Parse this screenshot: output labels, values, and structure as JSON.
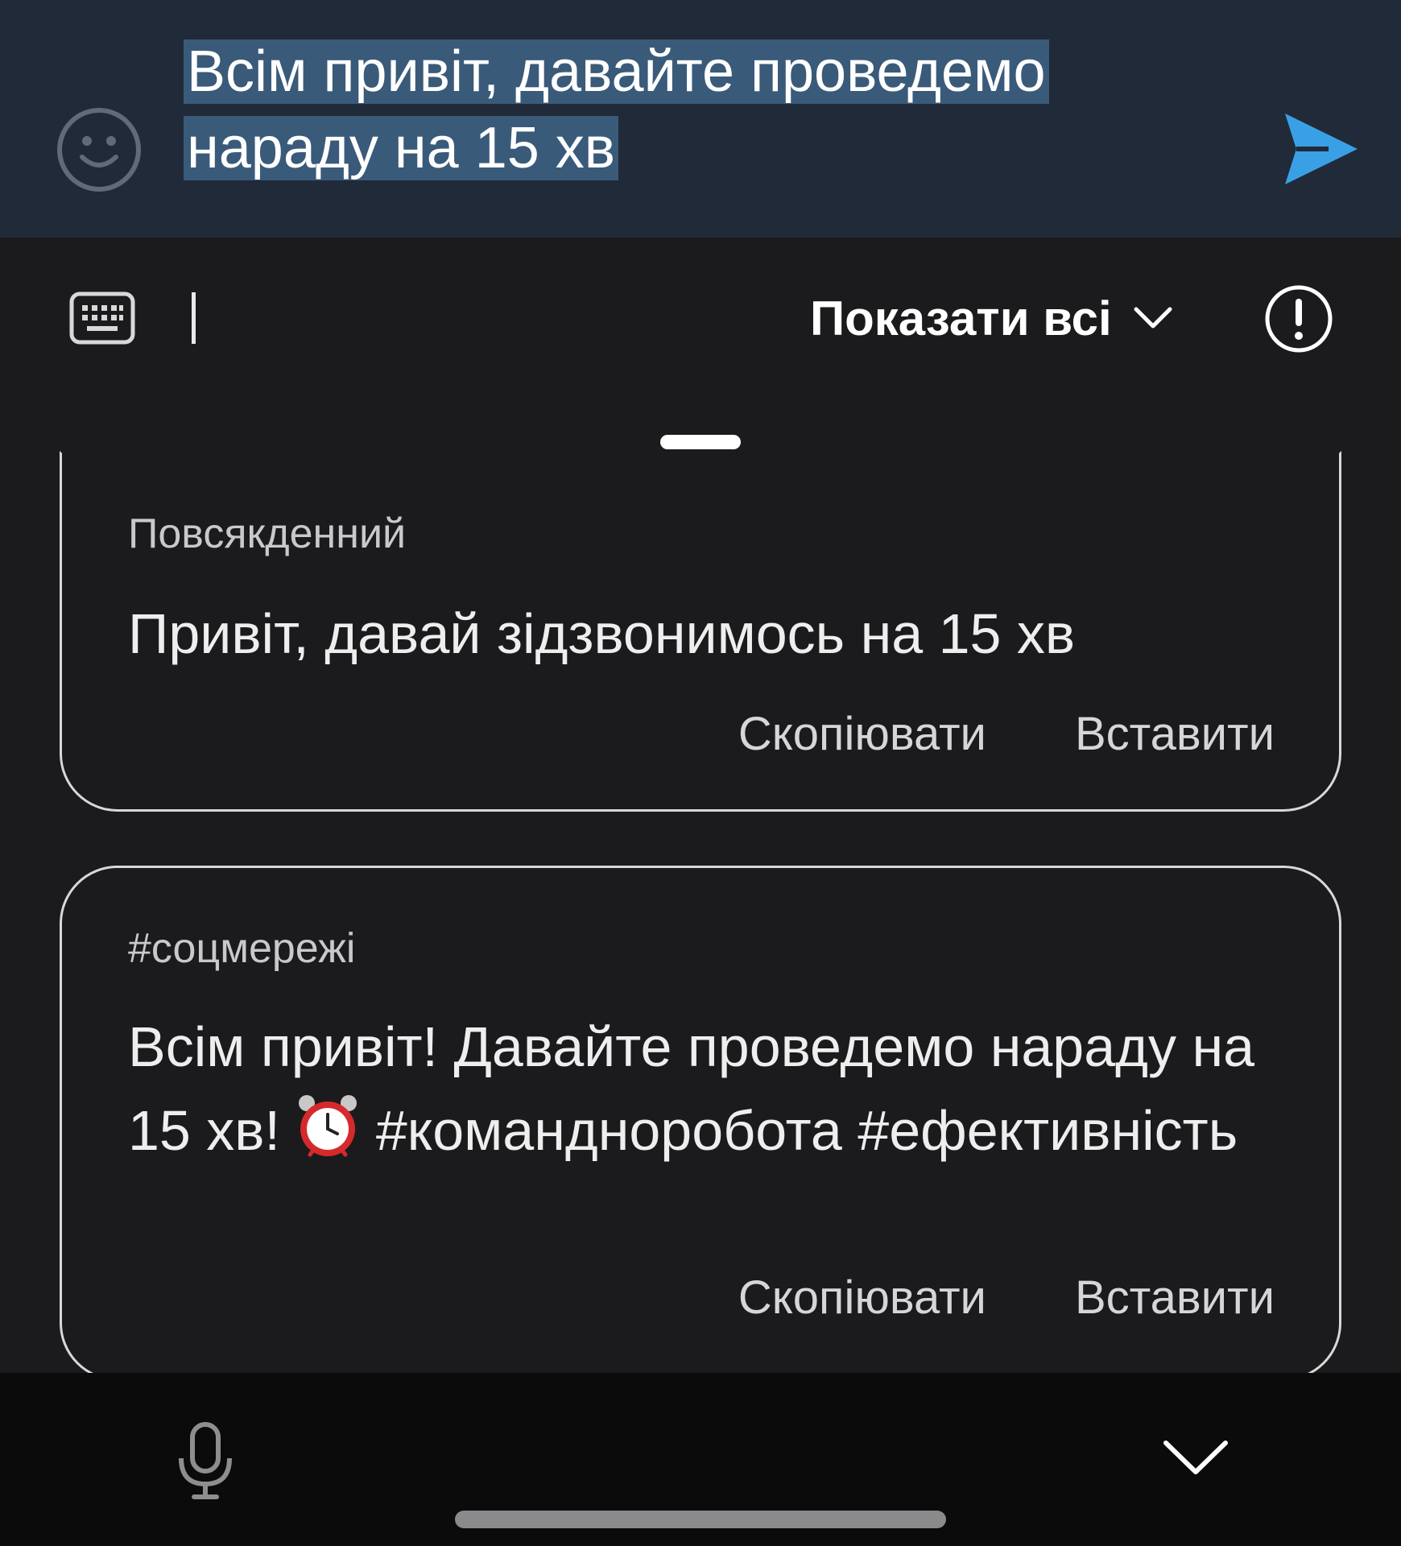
{
  "compose": {
    "message_line1": "Всім привіт, давайте проведемо",
    "message_line2": "нараду на 15 хв"
  },
  "toolbar": {
    "filter_label": "Показати всі"
  },
  "suggestions": [
    {
      "tag": "Повсякденний",
      "text": "Привіт, давай зідзвонимось на 15 хв",
      "copy_label": "Скопіювати",
      "insert_label": "Вставити"
    },
    {
      "tag": "#соцмережі",
      "text_part1": "Всім привіт! Давайте проведемо нараду на 15 хв!",
      "emoji": "alarm-clock",
      "text_part2": "#командноробота",
      "text_part2_actual": "#командноробота",
      "text_part3": "#ефективність",
      "copy_label": "Скопіювати",
      "insert_label": "Вставити"
    }
  ],
  "colors": {
    "compose_bg": "#212a38",
    "selection": "#3a5a7a",
    "send_accent": "#3aa0e6",
    "panel_bg": "#1b1b1d"
  }
}
